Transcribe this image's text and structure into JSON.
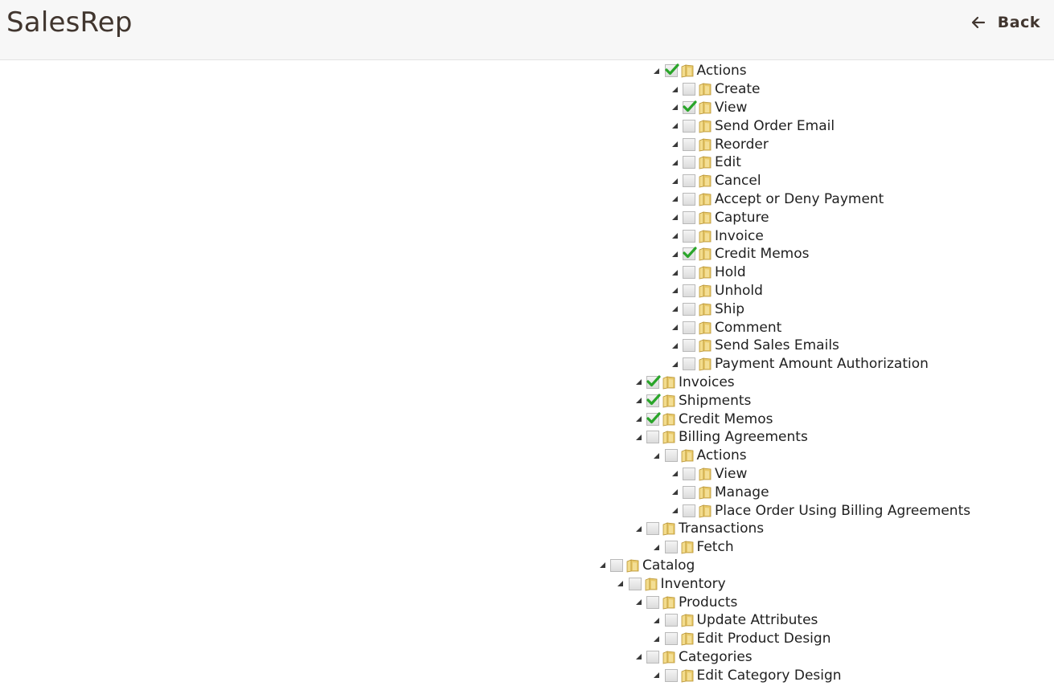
{
  "header": {
    "title": "SalesRep",
    "back_label": "Back"
  },
  "tree": {
    "nodes": [
      {
        "label": "Actions",
        "checked": true,
        "level": 3
      },
      {
        "label": "Create",
        "checked": false,
        "level": 4
      },
      {
        "label": "View",
        "checked": true,
        "level": 4
      },
      {
        "label": "Send Order Email",
        "checked": false,
        "level": 4
      },
      {
        "label": "Reorder",
        "checked": false,
        "level": 4
      },
      {
        "label": "Edit",
        "checked": false,
        "level": 4
      },
      {
        "label": "Cancel",
        "checked": false,
        "level": 4
      },
      {
        "label": "Accept or Deny Payment",
        "checked": false,
        "level": 4
      },
      {
        "label": "Capture",
        "checked": false,
        "level": 4
      },
      {
        "label": "Invoice",
        "checked": false,
        "level": 4
      },
      {
        "label": "Credit Memos",
        "checked": true,
        "level": 4
      },
      {
        "label": "Hold",
        "checked": false,
        "level": 4
      },
      {
        "label": "Unhold",
        "checked": false,
        "level": 4
      },
      {
        "label": "Ship",
        "checked": false,
        "level": 4
      },
      {
        "label": "Comment",
        "checked": false,
        "level": 4
      },
      {
        "label": "Send Sales Emails",
        "checked": false,
        "level": 4
      },
      {
        "label": "Payment Amount Authorization",
        "checked": false,
        "level": 4
      },
      {
        "label": "Invoices",
        "checked": true,
        "level": 2
      },
      {
        "label": "Shipments",
        "checked": true,
        "level": 2
      },
      {
        "label": "Credit Memos",
        "checked": true,
        "level": 2
      },
      {
        "label": "Billing Agreements",
        "checked": false,
        "level": 2
      },
      {
        "label": "Actions",
        "checked": false,
        "level": 3
      },
      {
        "label": "View",
        "checked": false,
        "level": 4
      },
      {
        "label": "Manage",
        "checked": false,
        "level": 4
      },
      {
        "label": "Place Order Using Billing Agreements",
        "checked": false,
        "level": 4
      },
      {
        "label": "Transactions",
        "checked": false,
        "level": 2
      },
      {
        "label": "Fetch",
        "checked": false,
        "level": 3
      },
      {
        "label": "Catalog",
        "checked": false,
        "level": 0
      },
      {
        "label": "Inventory",
        "checked": false,
        "level": 1
      },
      {
        "label": "Products",
        "checked": false,
        "level": 2
      },
      {
        "label": "Update Attributes",
        "checked": false,
        "level": 3
      },
      {
        "label": "Edit Product Design",
        "checked": false,
        "level": 3
      },
      {
        "label": "Categories",
        "checked": false,
        "level": 2
      },
      {
        "label": "Edit Category Design",
        "checked": false,
        "level": 3
      }
    ]
  },
  "icons": {
    "expand": "triangle-down-icon",
    "folder": "folder-icon",
    "check": "checkmark-icon",
    "back": "arrow-left-icon"
  },
  "colors": {
    "header_bg": "#f7f7f7",
    "title": "#41362f",
    "check_green": "#2aa52a",
    "folder": "#e8c96a"
  }
}
